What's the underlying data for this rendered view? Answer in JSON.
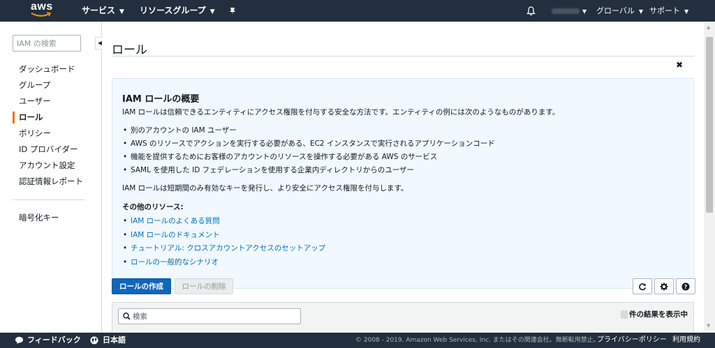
{
  "topnav": {
    "logo": "aws",
    "services": "サービス",
    "resource_groups": "リソースグループ",
    "pin_icon": "pin-icon",
    "bell_icon": "bell-icon",
    "region": "グローバル",
    "support": "サポート"
  },
  "sidebar": {
    "search_placeholder": "IAM の検索",
    "items": [
      {
        "label": "ダッシュボード"
      },
      {
        "label": "グループ"
      },
      {
        "label": "ユーザー"
      },
      {
        "label": "ロール"
      },
      {
        "label": "ポリシー"
      },
      {
        "label": "ID プロバイダー"
      },
      {
        "label": "アカウント設定"
      },
      {
        "label": "認証情報レポート"
      }
    ],
    "extra": "暗号化キー"
  },
  "main": {
    "title": "ロール",
    "info": {
      "title": "IAM ロールの概要",
      "description": "IAM ロールは信頼できるエンティティにアクセス権限を付与する安全な方法です。エンティティの例には次のようなものがあります。",
      "examples": [
        "別のアカウントの IAM ユーザー",
        "AWS のリソースでアクションを実行する必要がある、EC2 インスタンスで実行されるアプリケーションコード",
        "機能を提供するためにお客様のアカウントのリソースを操作する必要がある AWS のサービス",
        "SAML を使用した ID フェデレーションを使用する企業内ディレクトリからのユーザー"
      ],
      "note": "IAM ロールは短期間のみ有効なキーを発行し、より安全にアクセス権限を付与します。",
      "resources_heading": "その他のリソース:",
      "links": [
        "IAM ロールのよくある質問",
        "IAM ロールのドキュメント",
        "チュートリアル: クロスアカウントアクセスのセットアップ",
        "ロールの一般的なシナリオ"
      ],
      "close": "✖"
    },
    "create_button": "ロールの作成",
    "delete_button": "ロールの削除",
    "search_placeholder": "検索",
    "result_suffix": "件の結果を表示中"
  },
  "footer": {
    "feedback": "フィードバック",
    "language": "日本語",
    "copyright": "© 2008 - 2019, Amazon Web Services, Inc. またはその関連会社。無断転用禁止。",
    "privacy": "プライバシーポリシー",
    "terms": "利用規約"
  },
  "colors": {
    "nav_bg": "#232f3e",
    "accent": "#ec7211",
    "primary_button": "#1166bb",
    "link": "#0073bb",
    "info_bg": "#f1f8fe"
  }
}
